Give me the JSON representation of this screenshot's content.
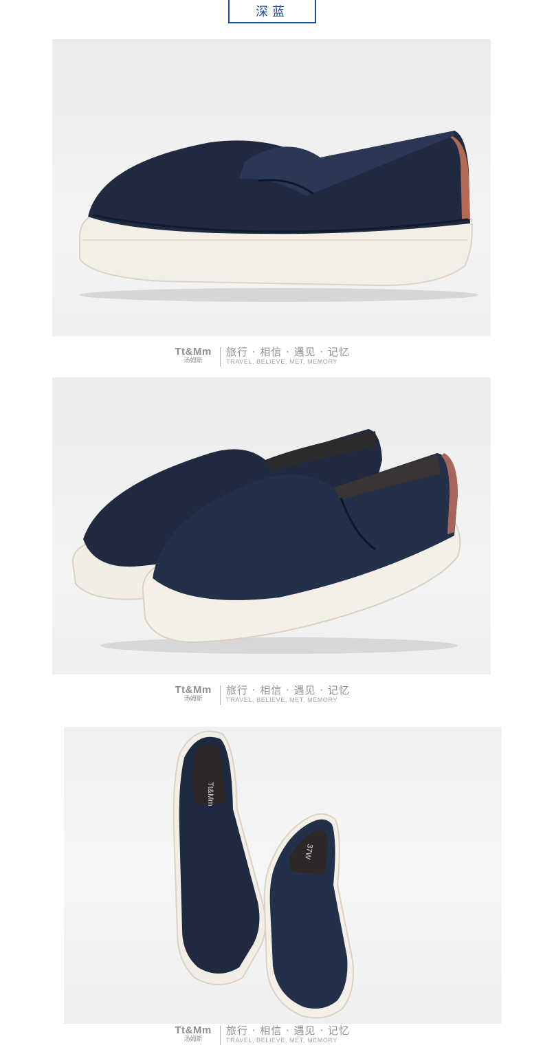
{
  "color_tag": {
    "label": "深蓝",
    "color": "#1d4f91"
  },
  "photos": [
    {
      "name": "shoe-side-view",
      "subject": "navy perforated leather slip-on platform sneaker, side view"
    },
    {
      "name": "shoe-pair-angle-view",
      "subject": "pair of navy slip-on sneakers, angled view"
    },
    {
      "name": "shoe-pair-top-view",
      "subject": "pair of navy slip-on sneakers, top view"
    }
  ],
  "brand": {
    "logo_en": "Tt&Mm",
    "logo_cn": "汤姆斯",
    "slogan_cn": "旅行 · 相信 · 遇见 · 记忆",
    "slogan_en": "TRAVEL, BELIEVE, MET, MEMORY"
  },
  "insole": {
    "logo": "Tt&Mm",
    "size": "37W"
  }
}
